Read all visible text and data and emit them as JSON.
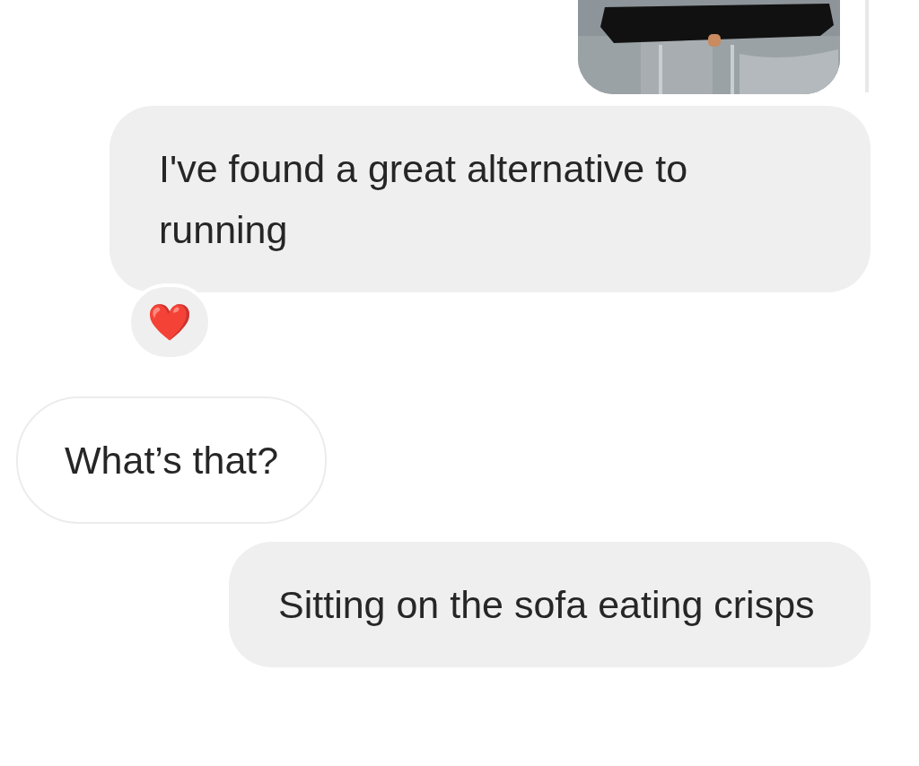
{
  "messages": [
    {
      "kind": "sent",
      "text": "I've found a great alternative to running",
      "reaction": "❤️"
    },
    {
      "kind": "received",
      "text": "What’s that?"
    },
    {
      "kind": "sent",
      "text": "Sitting on the sofa eating crisps"
    }
  ]
}
